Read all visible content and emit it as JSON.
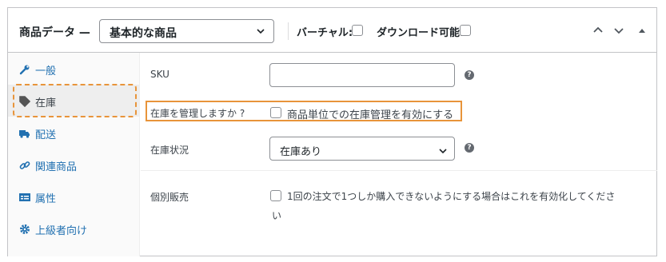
{
  "header": {
    "title": "商品データ —",
    "product_type": "基本的な商品",
    "virtual_label": "バーチャル:",
    "downloadable_label": "ダウンロード可能:",
    "buttons": [
      "chevron-up-icon",
      "chevron-down-icon",
      "toggle-panel-icon"
    ]
  },
  "sidebar": {
    "items": [
      {
        "label": "一般",
        "icon": "wrench-icon"
      },
      {
        "label": "在庫",
        "icon": "tag-icon"
      },
      {
        "label": "配送",
        "icon": "truck-icon"
      },
      {
        "label": "関連商品",
        "icon": "link-icon"
      },
      {
        "label": "属性",
        "icon": "list-icon"
      },
      {
        "label": "上級者向け",
        "icon": "gear-icon"
      }
    ],
    "active": "在庫"
  },
  "fields": {
    "sku_label": "SKU",
    "sku_value": "",
    "manage_stock_label": "在庫を管理しますか ?",
    "manage_stock_desc": "商品単位での在庫管理を有効にする",
    "stock_status_label": "在庫状況",
    "stock_status_value": "在庫あり",
    "sold_individually_label": "個別販売",
    "sold_individually_desc_line1": "1回の注文で1つしか購入できないようにする場合はこれを有効化してくださ",
    "sold_individually_desc_line2": "い"
  },
  "colors": {
    "link": "#2271b1",
    "highlight": "#e8943a",
    "border": "#c3c4c7"
  }
}
